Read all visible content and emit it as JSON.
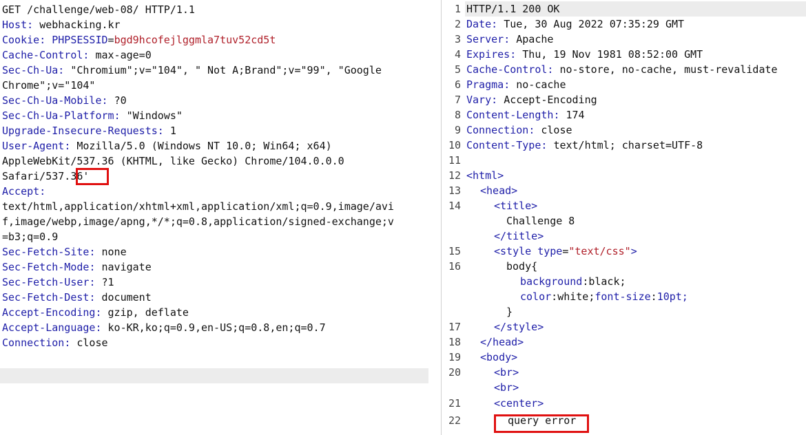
{
  "request": {
    "request_line": "GET /challenge/web-08/ HTTP/1.1",
    "host": {
      "name": "Host",
      "value": "webhacking.kr"
    },
    "cookie": {
      "name": "Cookie",
      "cookie_name": "PHPSESSID",
      "cookie_value": "bgd9hcofejlggmla7tuv52cd5t"
    },
    "cache_control": {
      "name": "Cache-Control",
      "value": "max-age=0"
    },
    "sec_ch_ua": {
      "name": "Sec-Ch-Ua",
      "value_1": "\"Chromium\";v=\"104\", \" Not A;Brand\";v=\"99\", \"Google",
      "value_2": "Chrome\";v=\"104\""
    },
    "sec_ch_ua_mobile": {
      "name": "Sec-Ch-Ua-Mobile",
      "value": "?0"
    },
    "sec_ch_ua_platform": {
      "name": "Sec-Ch-Ua-Platform",
      "value": "\"Windows\""
    },
    "upgrade_insecure": {
      "name": "Upgrade-Insecure-Requests",
      "value": "1"
    },
    "user_agent": {
      "name": "User-Agent",
      "value_1": "Mozilla/5.0 (Windows NT 10.0; Win64; x64)",
      "value_2": "AppleWebKit/537.36 (KHTML, like Gecko) Chrome/104.0.0.0",
      "value_3": "Safari/537.36'"
    },
    "accept": {
      "name": "Accept",
      "value_1": "text/html,application/xhtml+xml,application/xml;q=0.9,image/avi",
      "value_2": "f,image/webp,image/apng,*/*;q=0.8,application/signed-exchange;v",
      "value_3": "=b3;q=0.9"
    },
    "sec_fetch_site": {
      "name": "Sec-Fetch-Site",
      "value": "none"
    },
    "sec_fetch_mode": {
      "name": "Sec-Fetch-Mode",
      "value": "navigate"
    },
    "sec_fetch_user": {
      "name": "Sec-Fetch-User",
      "value": "?1"
    },
    "sec_fetch_dest": {
      "name": "Sec-Fetch-Dest",
      "value": "document"
    },
    "accept_encoding": {
      "name": "Accept-Encoding",
      "value": "gzip, deflate"
    },
    "accept_language": {
      "name": "Accept-Language",
      "value": "ko-KR,ko;q=0.9,en-US;q=0.8,en;q=0.7"
    },
    "connection": {
      "name": "Connection",
      "value": "close"
    }
  },
  "response": {
    "line_numbers": [
      "1",
      "2",
      "3",
      "4",
      "5",
      "6",
      "7",
      "8",
      "9",
      "10",
      "11",
      "12",
      "13",
      "14",
      "15",
      "16",
      "17",
      "18",
      "19",
      "20",
      "21",
      "22"
    ],
    "status_line": "HTTP/1.1 200 OK",
    "date": {
      "name": "Date",
      "value": "Tue, 30 Aug 2022 07:35:29 GMT"
    },
    "server": {
      "name": "Server",
      "value": "Apache"
    },
    "expires": {
      "name": "Expires",
      "value": "Thu, 19 Nov 1981 08:52:00 GMT"
    },
    "cache_control": {
      "name": "Cache-Control",
      "value": "no-store, no-cache, must-revalidate"
    },
    "pragma": {
      "name": "Pragma",
      "value": "no-cache"
    },
    "vary": {
      "name": "Vary",
      "value": "Accept-Encoding"
    },
    "content_length": {
      "name": "Content-Length",
      "value": "174"
    },
    "connection": {
      "name": "Connection",
      "value": "close"
    },
    "content_type": {
      "name": "Content-Type",
      "value": "text/html; charset=UTF-8"
    },
    "html": {
      "html_open": "<html>",
      "head_open": "<head>",
      "title_open": "<title>",
      "title_text": "Challenge 8",
      "title_close": "</title>",
      "style_open_tag": "<style",
      "style_attr_name": "type",
      "style_attr_value": "\"text/css\"",
      "style_open_end": ">",
      "css_selector": "body{",
      "css_bg_prop": "background",
      "css_bg_val": "black;",
      "css_color_prop": "color",
      "css_color_val": "white;",
      "css_fs_prop": "font-size",
      "css_fs_val": "10pt;",
      "css_close": "}",
      "style_close": "</style>",
      "head_close": "</head>",
      "body_open": "<body>",
      "br1": "<br>",
      "br2": "<br>",
      "center_open": "<center>",
      "query_error": "query error"
    }
  },
  "colors": {
    "highlight_box": "#e01010",
    "header_key": "#1e1ea8",
    "cookie_value": "#b0202a"
  }
}
